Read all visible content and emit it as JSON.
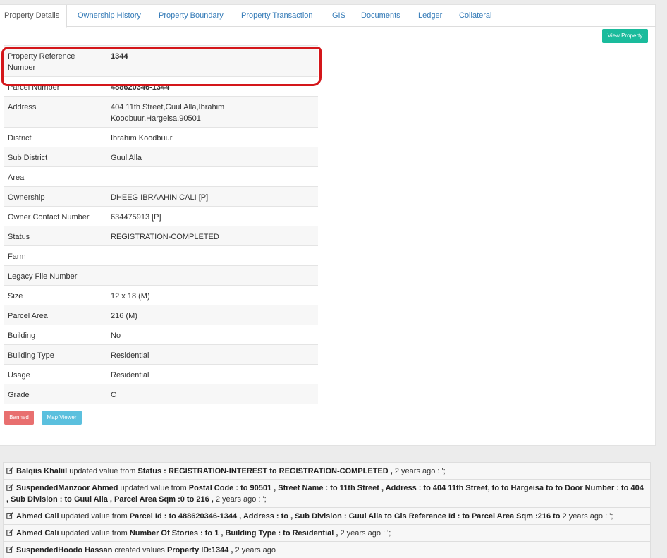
{
  "tabs": [
    {
      "label": "Property Details"
    },
    {
      "label": "Ownership History"
    },
    {
      "label": "Property Boundary"
    },
    {
      "label": "Property Transaction"
    },
    {
      "label": "GIS"
    },
    {
      "label": "Documents"
    },
    {
      "label": "Ledger"
    },
    {
      "label": "Collateral"
    }
  ],
  "buttons": {
    "view_property": "View Property",
    "banned": "Banned",
    "map_viewer": "Map Viewer"
  },
  "details": [
    {
      "label": "Property Reference Number",
      "value": "1344"
    },
    {
      "label": "Parcel Number",
      "value": "488620346-1344"
    },
    {
      "label": "Address",
      "value": "404 11th Street,Guul Alla,Ibrahim Koodbuur,Hargeisa,90501"
    },
    {
      "label": "District",
      "value": "Ibrahim Koodbuur"
    },
    {
      "label": "Sub District",
      "value": "Guul Alla"
    },
    {
      "label": "Area",
      "value": ""
    },
    {
      "label": "Ownership",
      "value": "DHEEG IBRAAHIN CALI [P]"
    },
    {
      "label": "Owner Contact Number",
      "value": "634475913 [P]"
    },
    {
      "label": "Status",
      "value": "REGISTRATION-COMPLETED"
    },
    {
      "label": "Farm",
      "value": ""
    },
    {
      "label": "Legacy File Number",
      "value": ""
    },
    {
      "label": "Size",
      "value": "12 x 18 (M)"
    },
    {
      "label": "Parcel Area",
      "value": "216 (M)"
    },
    {
      "label": "Building",
      "value": "No"
    },
    {
      "label": "Building Type",
      "value": "Residential"
    },
    {
      "label": "Usage",
      "value": "Residential"
    },
    {
      "label": "Grade",
      "value": "C"
    }
  ],
  "logs": [
    {
      "user": "Balqiis Khaliil",
      "action": " updated value from ",
      "changes": "Status : REGISTRATION-INTEREST to REGISTRATION-COMPLETED ,",
      "time": " 2 years ago : ';"
    },
    {
      "user": "SuspendedManzoor Ahmed",
      "action": " updated value from ",
      "changes": "Postal Code : to 90501 , Street Name : to 11th Street , Address : to 404 11th Street, to to Hargeisa to to Door Number : to 404 , Sub Division : to Guul Alla , Parcel Area Sqm :0 to 216 ,",
      "time": " 2 years ago : ';"
    },
    {
      "user": "Ahmed Cali",
      "action": " updated value from ",
      "changes": "Parcel Id : to 488620346-1344 , Address : to , Sub Division : Guul Alla to Gis Reference Id : to Parcel Area Sqm :216 to",
      "time": " 2 years ago : ';"
    },
    {
      "user": "Ahmed Cali",
      "action": " updated value from ",
      "changes": "Number Of Stories : to 1 , Building Type : to Residential ,",
      "time": " 2 years ago : ';"
    },
    {
      "user": "SuspendedHoodo Hassan",
      "action": " created values ",
      "changes": "Property ID:1344 ,",
      "time": " 2 years ago"
    }
  ]
}
